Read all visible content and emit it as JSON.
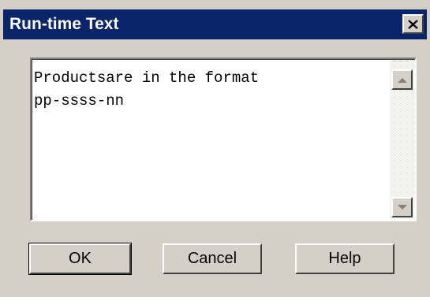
{
  "window": {
    "title": "Run-time Text"
  },
  "editor": {
    "line1": "Productsare in the format",
    "line2": "pp-ssss-nn"
  },
  "buttons": {
    "ok": "OK",
    "cancel": "Cancel",
    "help": "Help"
  },
  "icons": {
    "close": "close-icon",
    "scroll_up": "arrow-up-icon",
    "scroll_down": "arrow-down-icon"
  },
  "colors": {
    "titlebar": "#0a246a",
    "face": "#d4d0c8"
  }
}
